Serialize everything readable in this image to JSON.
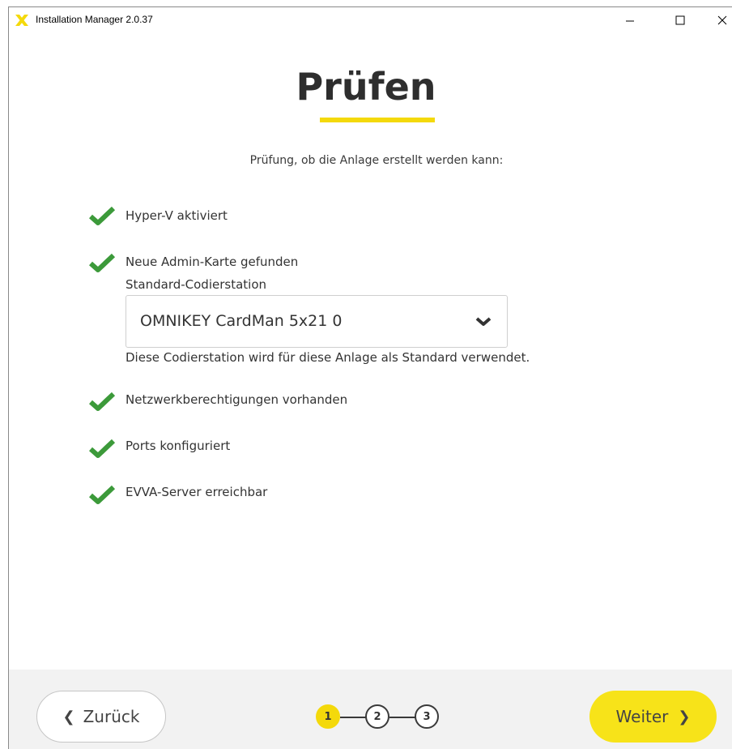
{
  "window": {
    "title": "Installation Manager 2.0.37",
    "minimize_icon": "minimize-icon",
    "maximize_icon": "maximize-icon",
    "close_icon": "close-icon"
  },
  "page": {
    "heading": "Prüfen",
    "subtitle": "Prüfung, ob die Anlage erstellt werden kann:"
  },
  "checks": [
    {
      "label": "Hyper-V aktiviert",
      "status": "ok"
    },
    {
      "label": "Neue Admin-Karte gefunden",
      "status": "ok"
    },
    {
      "label": "Netzwerkberechtigungen vorhanden",
      "status": "ok"
    },
    {
      "label": "Ports konfiguriert",
      "status": "ok"
    },
    {
      "label": "EVVA-Server erreichbar",
      "status": "ok"
    }
  ],
  "encoder": {
    "label": "Standard-Codierstation",
    "selected": "OMNIKEY CardMan 5x21 0",
    "hint": "Diese Codierstation wird für diese Anlage als Standard verwendet."
  },
  "footer": {
    "back_label": "Zurück",
    "next_label": "Weiter",
    "back_arrow": "❮",
    "next_arrow": "❯",
    "steps": [
      "1",
      "2",
      "3"
    ],
    "active_step": 1
  },
  "colors": {
    "accent": "#f4d90b",
    "check_green": "#3c9a3a",
    "footer_bg": "#f2f2f2"
  }
}
